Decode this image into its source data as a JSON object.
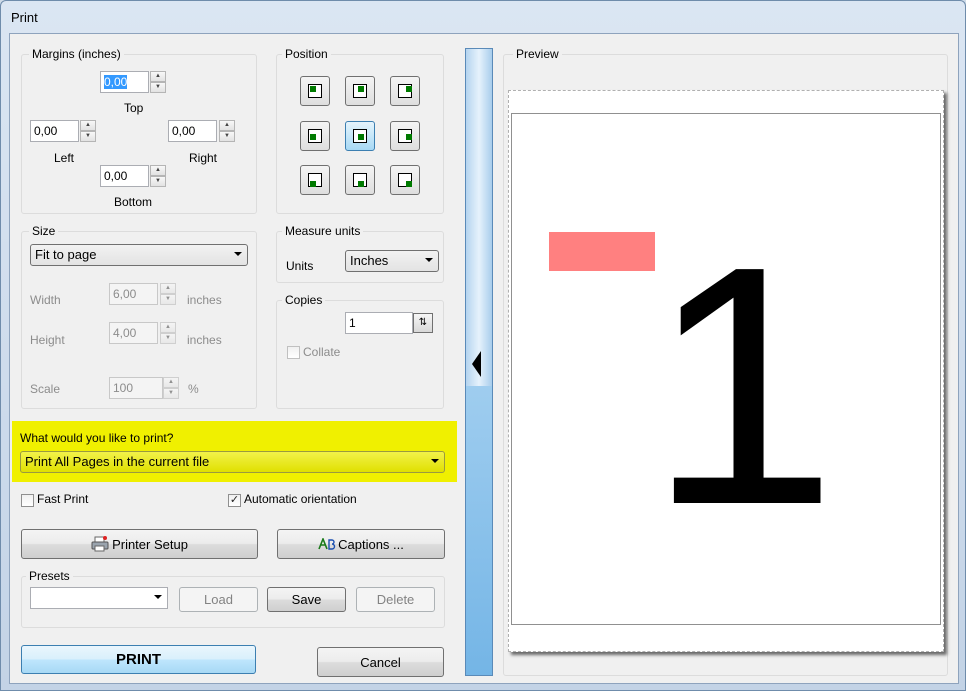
{
  "window": {
    "title": "Print"
  },
  "margins": {
    "title": "Margins (inches)",
    "top": {
      "label": "Top",
      "value": "0,00"
    },
    "left": {
      "label": "Left",
      "value": "0,00"
    },
    "right": {
      "label": "Right",
      "value": "0,00"
    },
    "bottom": {
      "label": "Bottom",
      "value": "0,00"
    }
  },
  "position": {
    "title": "Position",
    "buttons": [
      {
        "icon": "align-top-left-icon"
      },
      {
        "icon": "align-top-center-icon"
      },
      {
        "icon": "align-top-right-icon"
      },
      {
        "icon": "align-middle-left-icon"
      },
      {
        "icon": "align-center-icon",
        "selected": true
      },
      {
        "icon": "align-middle-right-icon"
      },
      {
        "icon": "align-bottom-left-icon"
      },
      {
        "icon": "align-bottom-center-icon"
      },
      {
        "icon": "align-bottom-right-icon"
      }
    ],
    "marker_color": "#007a00"
  },
  "size": {
    "title": "Size",
    "mode": "Fit to page",
    "width": {
      "label": "Width",
      "value": "6,00",
      "unit": "inches"
    },
    "height": {
      "label": "Height",
      "value": "4,00",
      "unit": "inches"
    },
    "scale": {
      "label": "Scale",
      "value": "100",
      "unit": "%"
    }
  },
  "measure": {
    "title": "Measure units",
    "units_label": "Units",
    "units_value": "Inches"
  },
  "copies": {
    "title": "Copies",
    "value": "1",
    "collate_label": "Collate",
    "collate_checked": false
  },
  "print_what": {
    "question": "What would you like to print?",
    "selection": "Print All Pages in the current file",
    "highlight_color": "#f0f000"
  },
  "options": {
    "fast_print_label": "Fast Print",
    "fast_print_checked": false,
    "auto_orientation_label": "Automatic orientation",
    "auto_orientation_checked": true
  },
  "buttons": {
    "printer_setup": "Printer Setup",
    "captions": "Captions ...",
    "print": "PRINT",
    "cancel": "Cancel"
  },
  "presets": {
    "title": "Presets",
    "selected": "",
    "load": "Load",
    "save": "Save",
    "delete": "Delete"
  },
  "preview": {
    "title": "Preview",
    "page_text": "1",
    "shape_color": "#ff8080"
  },
  "check_mark": "✓"
}
